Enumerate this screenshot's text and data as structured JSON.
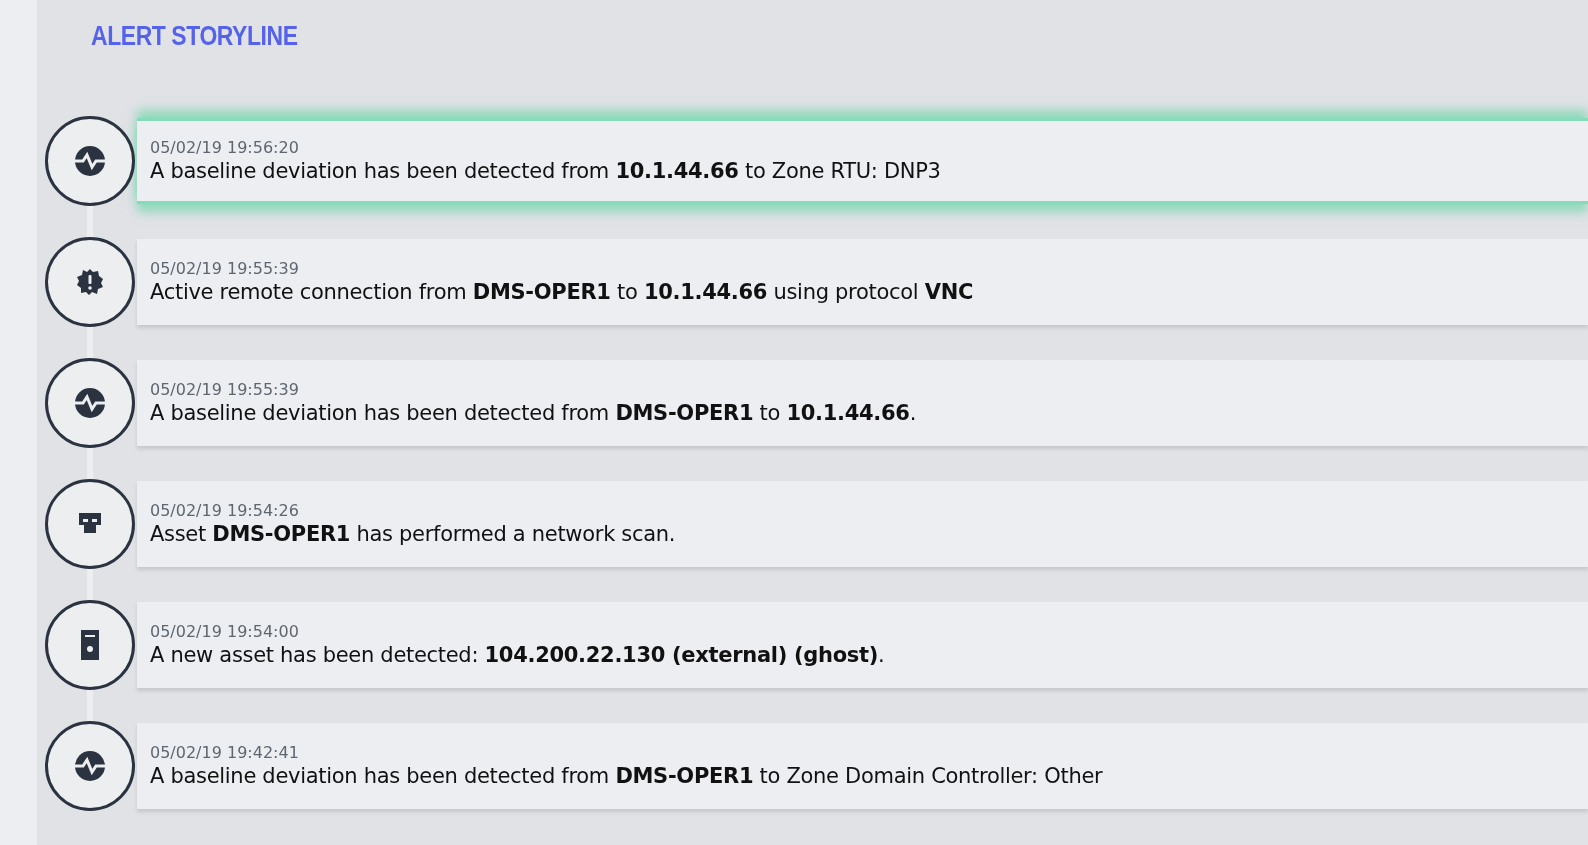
{
  "title": "ALERT STORYLINE",
  "events": [
    {
      "kind": "deviation",
      "selected": true,
      "time": "05/02/19 19:56:20",
      "message": "A baseline deviation has been detected from **10.1.44.66** to Zone RTU: DNP3"
    },
    {
      "kind": "alert",
      "selected": false,
      "time": "05/02/19 19:55:39",
      "message": "Active remote connection from **DMS-OPER1** to **10.1.44.66** using protocol **VNC**"
    },
    {
      "kind": "deviation",
      "selected": false,
      "time": "05/02/19 19:55:39",
      "message": "A baseline deviation has been detected from **DMS-OPER1** to **10.1.44.66**."
    },
    {
      "kind": "scan",
      "selected": false,
      "time": "05/02/19 19:54:26",
      "message": "Asset **DMS-OPER1** has performed a network scan."
    },
    {
      "kind": "asset",
      "selected": false,
      "time": "05/02/19 19:54:00",
      "message": "A new asset has been detected: **104.200.22.130 (external) (ghost)**."
    },
    {
      "kind": "deviation",
      "selected": false,
      "time": "05/02/19 19:42:41",
      "message": "A baseline deviation has been detected from **DMS-OPER1** to Zone Domain Controller: Other"
    }
  ]
}
